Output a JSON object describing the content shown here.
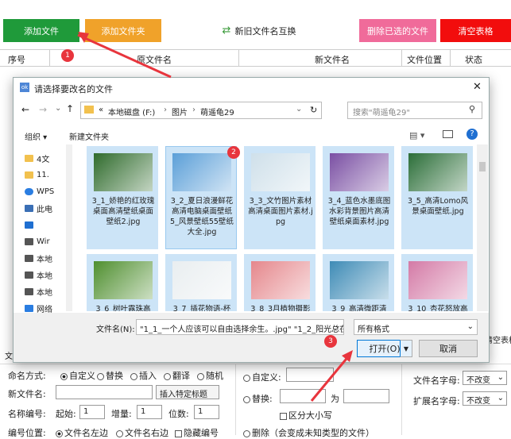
{
  "toolbar": {
    "add_file": "添加文件",
    "add_folder": "添加文件夹",
    "swap_names": "新旧文件名互换",
    "delete_selected": "删除已选的文件",
    "clear_table": "清空表格"
  },
  "table": {
    "headers": [
      "序号",
      "原文件名",
      "新文件名",
      "文件位置",
      "状态"
    ]
  },
  "dialog": {
    "title": "请选择要改名的文件",
    "close": "✕",
    "breadcrumb": [
      "«",
      "本地磁盘 (F:)",
      "图片",
      "萌遥龟29"
    ],
    "search_placeholder": "搜索\"萌遥龟29\"",
    "organize": "组织 ▾",
    "new_folder": "新建文件夹",
    "sidebar": [
      {
        "label": "4文",
        "icon": "folder-icon"
      },
      {
        "label": "11.",
        "icon": "folder-icon"
      },
      {
        "label": "WPS",
        "icon": "cloud-icon"
      },
      {
        "label": "此电",
        "icon": "computer-icon"
      },
      {
        "label": "",
        "icon": "app-icon"
      },
      {
        "label": "Wir",
        "icon": "drive-icon"
      },
      {
        "label": "本地",
        "icon": "drive-icon"
      },
      {
        "label": "本地",
        "icon": "drive-icon"
      },
      {
        "label": "本地",
        "icon": "drive-icon"
      },
      {
        "label": "网络",
        "icon": "network-icon"
      }
    ],
    "files": [
      {
        "name": "3_1_娇艳的红玫瑰桌面高清壁纸桌面壁纸2.jpg",
        "color": "#2f6b2c"
      },
      {
        "name": "3_2_夏日浪漫鲜花高清电脑桌面壁纸 5_风景壁纸55壁纸大全.jpg",
        "color": "#5b9fd8"
      },
      {
        "name": "3_3_文竹图片素材高清桌面图片素材.jpg",
        "color": "#cfe0ea"
      },
      {
        "name": "3_4_蓝色水墨底图水彩背景图片高清壁纸桌面素材.jpg",
        "color": "#7a4fa3"
      },
      {
        "name": "3_5_高清Lomo风景桌面壁纸.jpg",
        "color": "#2b6e38"
      },
      {
        "name": "3_6_树叶露珠高",
        "color": "#4f8f2f"
      },
      {
        "name": "3_7_插花物语-杯",
        "color": "#e9eef0"
      },
      {
        "name": "3_8_3月植物摄影",
        "color": "#e5878c"
      },
      {
        "name": "3_9_高清微距清",
        "color": "#3e8bb6"
      },
      {
        "name": "3_10_杏花怒放高",
        "color": "#d47aa6"
      }
    ],
    "filename_label": "文件名(N):",
    "filename_value": "\"1_1_一个人应该可以自由选择余生。.jpg\" \"1_2_阳光总在",
    "filter_value": "所有格式",
    "open_button": "打开(O)",
    "cancel_button": "取消"
  },
  "settings": {
    "naming_mode_label": "命名方式:",
    "naming_modes": [
      "自定义",
      "替换",
      "插入",
      "翻译",
      "随机"
    ],
    "new_name_label": "新文件名:",
    "insert_tag": "插入特定标题",
    "numbering_label": "名称编号:",
    "start_label": "起始:",
    "start_value": "1",
    "step_label": "增量:",
    "step_value": "1",
    "digits_label": "位数:",
    "digits_value": "1",
    "position_label": "编号位置:",
    "position_left": "文件名左边",
    "position_right": "文件名右边",
    "hide_number": "隐藏编号",
    "custom_label": "自定义:",
    "replace_label": "替换:",
    "replace_with": "为",
    "case_sensitive": "区分大小写",
    "delete_label": "删除（会变成未知类型的文件）",
    "filename_case_label": "文件名字母:",
    "filename_case_value": "不改变",
    "ext_case_label": "扩展名字母:",
    "ext_case_value": "不改变",
    "right_edge_label": "清空表格",
    "left_edge_letter": "文"
  },
  "annotations": [
    "1",
    "2",
    "3"
  ],
  "colors": {
    "arrow": "#e8353d",
    "accent": "#0078d7"
  }
}
